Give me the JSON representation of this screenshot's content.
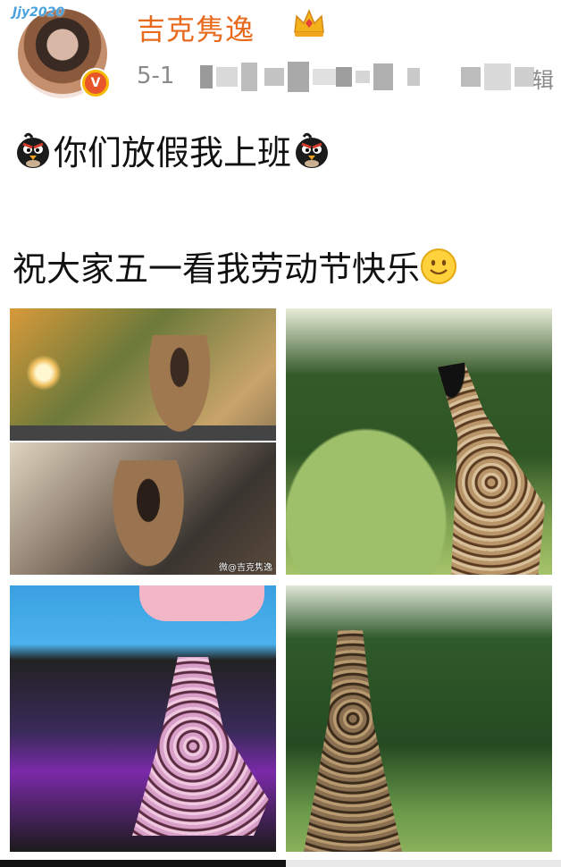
{
  "post": {
    "username": "吉克隽逸",
    "avatar_deco_text": "Jjy2020",
    "date": "5-1",
    "verified_badge": "V",
    "meta_edge_char": "辑",
    "text_line1": "你们放假我上班",
    "text_line2": "祝大家五一看我劳动节快乐",
    "watermark": "微@吉克隽逸"
  },
  "icons": {
    "crown": "crown-icon",
    "bird": "black-bird-emoji",
    "smile": "smile-emoji"
  },
  "colors": {
    "username": "#e86a1c",
    "verified_outer": "#f6b800",
    "verified_inner": "#e9552a",
    "date": "#8a8a8a"
  }
}
